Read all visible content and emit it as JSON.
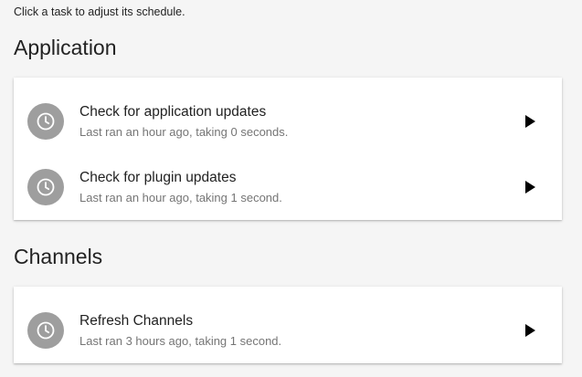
{
  "intro": "Click a task to adjust its schedule.",
  "sections": [
    {
      "title": "Application",
      "tasks": [
        {
          "name": "Check for application updates",
          "status": "Last ran an hour ago, taking 0 seconds.",
          "icon": "clock-icon",
          "action_icon": "play-icon"
        },
        {
          "name": "Check for plugin updates",
          "status": "Last ran an hour ago, taking 1 second.",
          "icon": "clock-icon",
          "action_icon": "play-icon"
        }
      ]
    },
    {
      "title": "Channels",
      "tasks": [
        {
          "name": "Refresh Channels",
          "status": "Last ran 3 hours ago, taking 1 second.",
          "icon": "clock-icon",
          "action_icon": "play-icon"
        }
      ]
    }
  ],
  "colors": {
    "page_background": "#f5f5f5",
    "card_background": "#ffffff",
    "icon_circle": "#9e9e9e",
    "secondary_text": "#757575"
  }
}
